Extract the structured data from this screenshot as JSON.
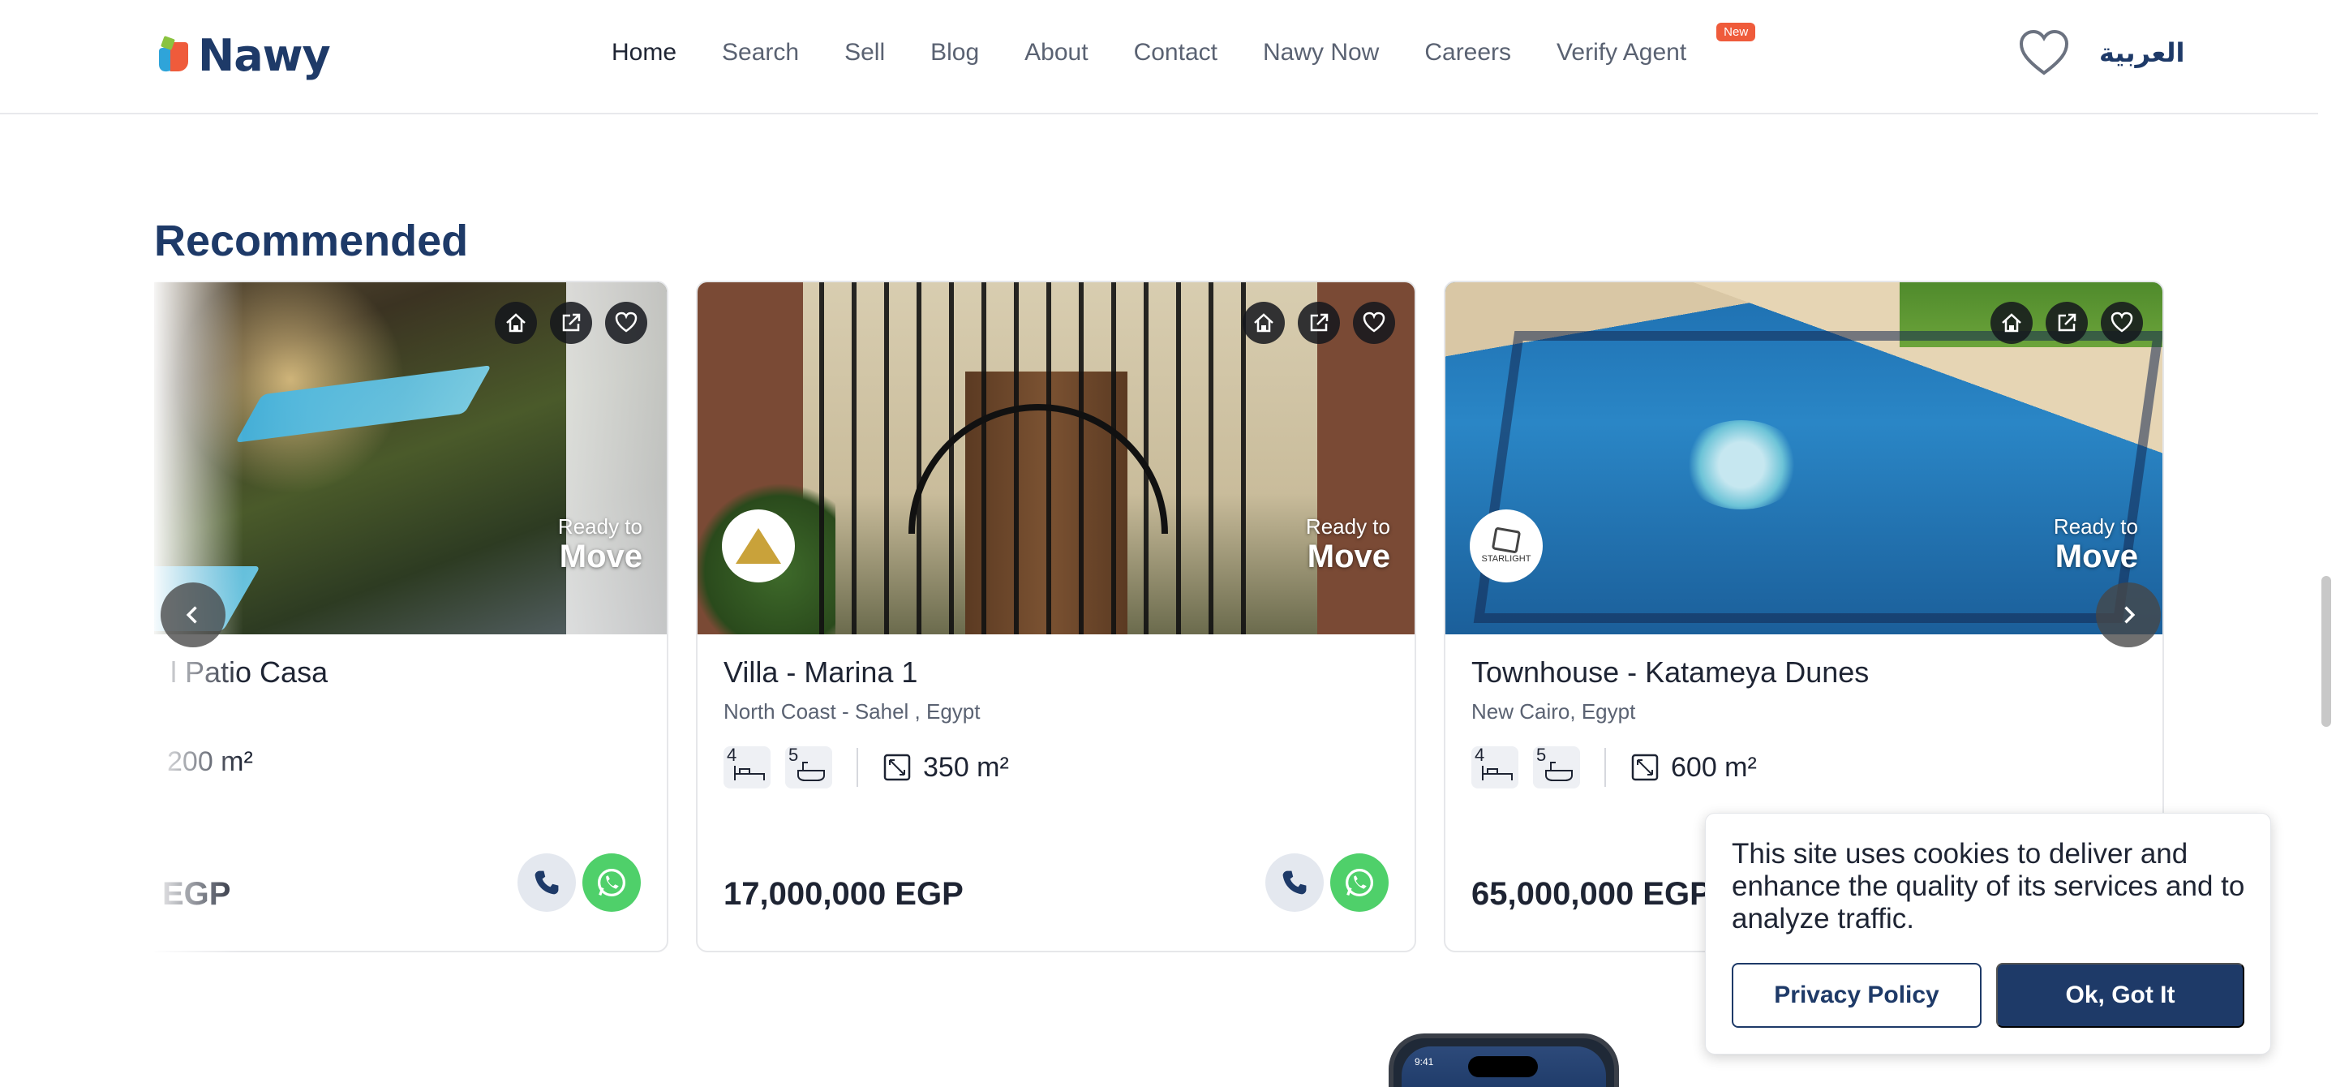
{
  "header": {
    "logo_text": "Nawy",
    "nav": [
      {
        "label": "Home",
        "active": true
      },
      {
        "label": "Search"
      },
      {
        "label": "Sell"
      },
      {
        "label": "Blog"
      },
      {
        "label": "About"
      },
      {
        "label": "Contact"
      },
      {
        "label": "Nawy Now"
      },
      {
        "label": "Careers"
      },
      {
        "label": "Verify Agent",
        "badge": "New"
      }
    ],
    "language": "العربية"
  },
  "section": {
    "title": "Recommended"
  },
  "cards": [
    {
      "title": "l Patio Casa",
      "location": "",
      "status_line1": "Ready to",
      "status_line2": "Move",
      "area": "200 m²",
      "price": "EGP"
    },
    {
      "title": "Villa - Marina 1",
      "location": "North Coast - Sahel , Egypt",
      "status_line1": "Ready to",
      "status_line2": "Move",
      "bedrooms": "4",
      "bathrooms": "5",
      "area": "350 m²",
      "price": "17,000,000 EGP"
    },
    {
      "title": "Townhouse - Katameya Dunes",
      "location": "New Cairo, Egypt",
      "status_line1": "Ready to",
      "status_line2": "Move",
      "bedrooms": "4",
      "bathrooms": "5",
      "area": "600 m²",
      "price": "65,000,000 EGP",
      "developer_logo_text": "STARLIGHT"
    }
  ],
  "cookie_banner": {
    "text": "This site uses cookies to deliver and enhance the quality of its services and to analyze traffic.",
    "privacy_label": "Privacy Policy",
    "ok_label": "Ok, Got It"
  },
  "phone_time": "9:41",
  "colors": {
    "brand_navy": "#1e3a68",
    "accent_orange": "#ef5b3b",
    "whatsapp_green": "#4fd06a"
  }
}
